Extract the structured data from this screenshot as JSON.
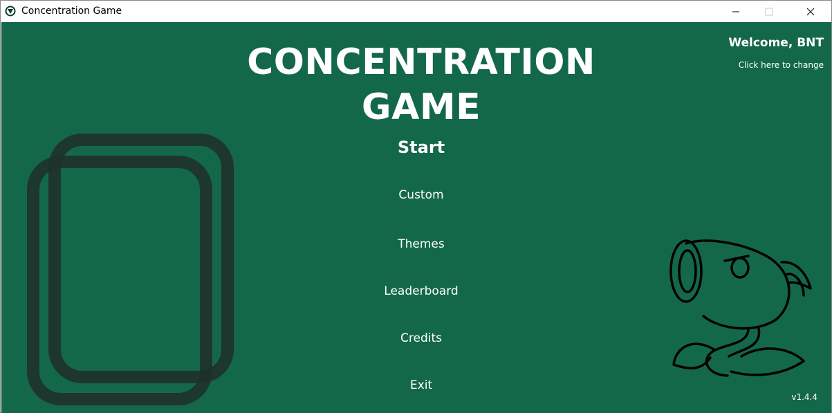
{
  "window": {
    "title": "Concentration Game",
    "app_icon": "game-logo-icon",
    "controls": [
      "minimize-icon",
      "maximize-icon",
      "close-icon"
    ]
  },
  "game": {
    "title_line1": "CONCENTRATION",
    "title_line2": "GAME"
  },
  "menu": {
    "start": "Start",
    "custom": "Custom",
    "themes": "Themes",
    "leaderboard": "Leaderboard",
    "credits": "Credits",
    "exit": "Exit"
  },
  "user": {
    "welcome": "Welcome, BNT",
    "change_link": "Click here to change"
  },
  "version": "v1.4.4",
  "decor": {
    "left_art": "card-stack-icon",
    "right_art": "peashooter-mascot-icon"
  },
  "colors": {
    "background": "#14684a",
    "text": "#ffffff",
    "card_outline": "#1f2f29"
  }
}
